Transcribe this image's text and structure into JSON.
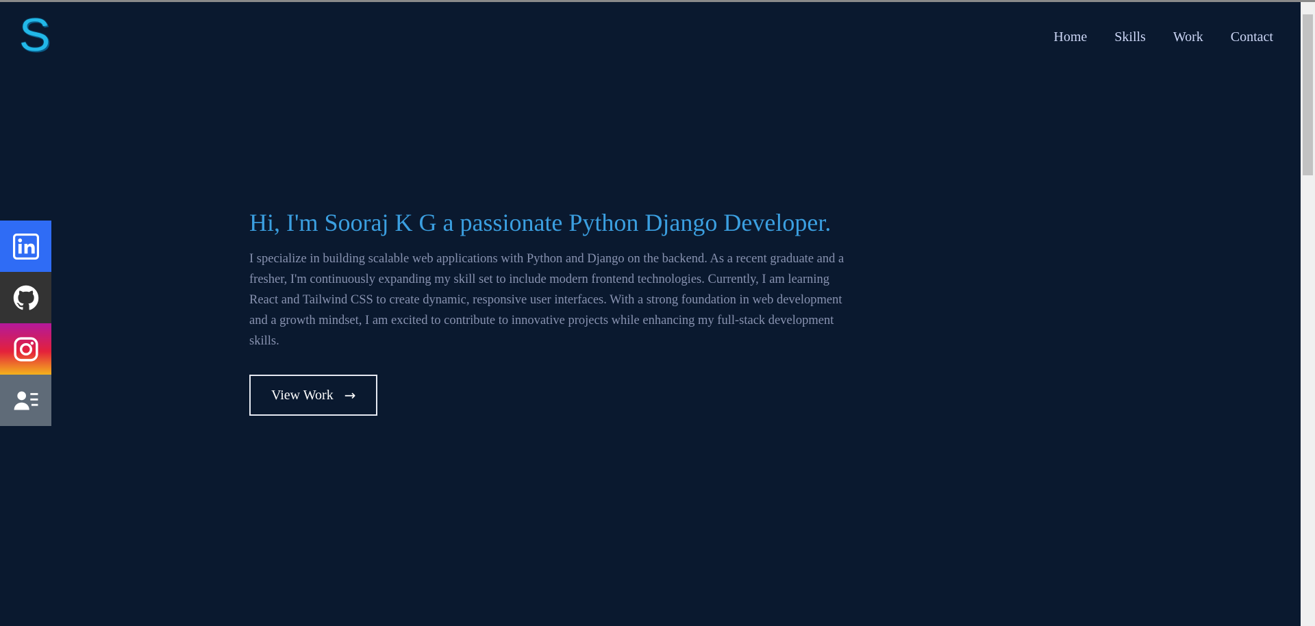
{
  "logo": {
    "letter": "S"
  },
  "nav": {
    "items": [
      {
        "label": "Home"
      },
      {
        "label": "Skills"
      },
      {
        "label": "Work"
      },
      {
        "label": "Contact"
      }
    ]
  },
  "social": {
    "items": [
      {
        "name": "linkedin",
        "icon": "linkedin-icon",
        "color": "#2f6cf5"
      },
      {
        "name": "github",
        "icon": "github-icon",
        "color": "#333333"
      },
      {
        "name": "instagram",
        "icon": "instagram-icon",
        "color": "#e4213b"
      },
      {
        "name": "resume",
        "icon": "contact-card-icon",
        "color": "#5f6b78"
      }
    ]
  },
  "hero": {
    "title": "Hi, I'm Sooraj K G a passionate Python Django Developer.",
    "description": "I specialize in building scalable web applications with Python and Django on the backend. As a recent graduate and a fresher, I'm continuously expanding my skill set to include modern frontend technologies. Currently, I am learning React and Tailwind CSS to create dynamic, responsive user interfaces. With a strong foundation in web development and a growth mindset, I am excited to contribute to innovative projects while enhancing my full-stack development skills.",
    "button_label": "View Work",
    "button_icon": "arrow-right-icon"
  },
  "colors": {
    "background": "#0a192f",
    "accent": "#3b9fe0",
    "logo": "#22b8e8",
    "text": "#8892b0",
    "nav_text": "#ccd6f6"
  }
}
